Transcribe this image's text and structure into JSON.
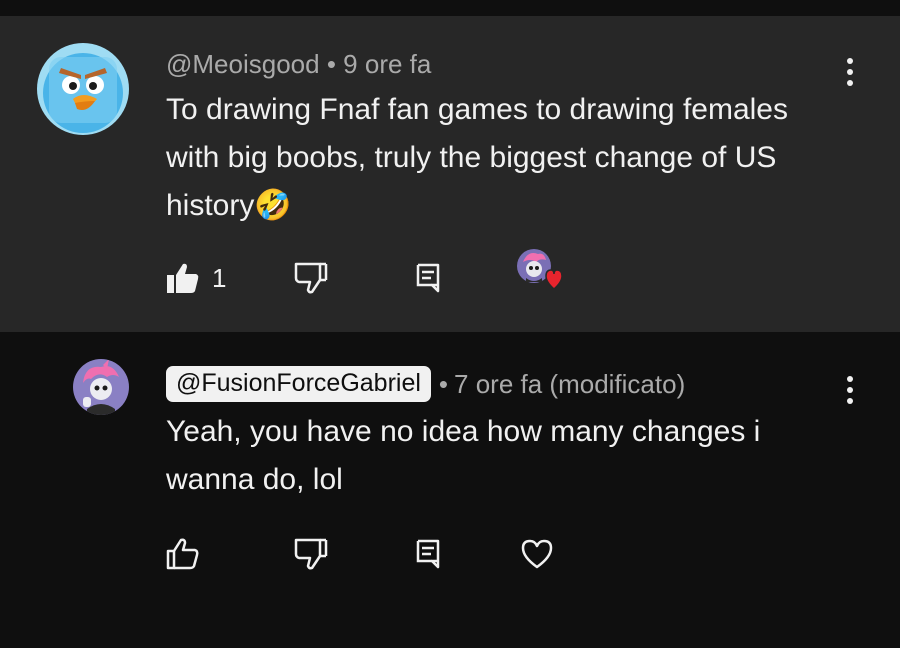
{
  "comments": [
    {
      "handle": "@Meoisgood",
      "separator": "•",
      "time": "9 ore fa",
      "text": "To drawing Fnaf fan games to drawing females with big boobs, truly the biggest change of US history",
      "emoji": "🤣",
      "like_count": "1",
      "liked": true,
      "creator_hearted": true,
      "avatar_icon": "angry-bird-ice-avatar"
    },
    {
      "handle": "@FusionForceGabriel",
      "separator": "•",
      "time": "7 ore fa (modificato)",
      "text": "Yeah, you have no idea how many changes i wanna do, lol",
      "liked": false,
      "creator_hearted": false,
      "avatar_icon": "pink-haired-character-avatar"
    }
  ],
  "colors": {
    "highlight_bg": "#272727",
    "page_bg": "#0f0f0f",
    "meta_text": "#aaaaaa",
    "body_text": "#f1f1f1",
    "heart_red": "#e7242d"
  }
}
